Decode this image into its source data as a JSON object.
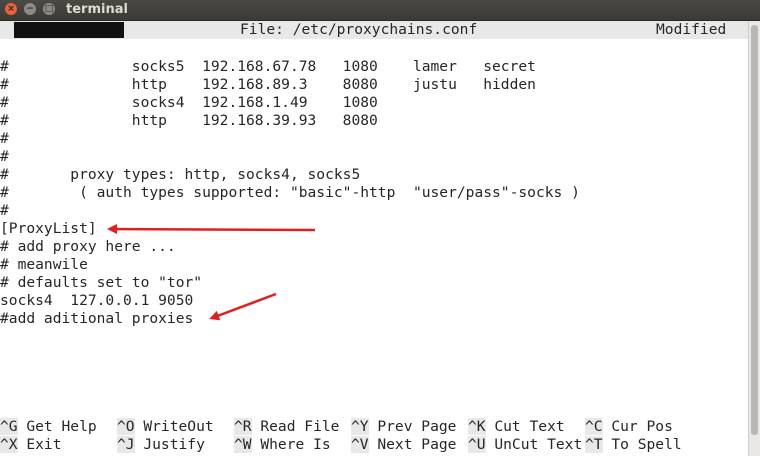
{
  "window": {
    "title": "terminal",
    "close_glyph": "×",
    "min_glyph": "−",
    "max_glyph": "□"
  },
  "nano": {
    "file_label": "File: /etc/proxychains.conf",
    "status": "Modified"
  },
  "editor_lines": [
    "#              socks5  192.168.67.78   1080    lamer   secret",
    "#              http    192.168.89.3    8080    justu   hidden",
    "#              socks4  192.168.1.49    1080",
    "#              http    192.168.39.93   8080",
    "#",
    "#",
    "#       proxy types: http, socks4, socks5",
    "#        ( auth types supported: \"basic\"-http  \"user/pass\"-socks )",
    "#",
    "[ProxyList]",
    "# add proxy here ...",
    "# meanwile",
    "# defaults set to \"tor\"",
    "socks4  127.0.0.1 9050",
    "#add aditional proxies"
  ],
  "shortcuts_row1": [
    {
      "key": "^G",
      "label": " Get Help"
    },
    {
      "key": "^O",
      "label": " WriteOut"
    },
    {
      "key": "^R",
      "label": " Read File"
    },
    {
      "key": "^Y",
      "label": " Prev Page"
    },
    {
      "key": "^K",
      "label": " Cut Text"
    },
    {
      "key": "^C",
      "label": " Cur Pos"
    }
  ],
  "shortcuts_row2": [
    {
      "key": "^X",
      "label": " Exit"
    },
    {
      "key": "^J",
      "label": " Justify"
    },
    {
      "key": "^W",
      "label": " Where Is"
    },
    {
      "key": "^V",
      "label": " Next Page"
    },
    {
      "key": "^U",
      "label": " UnCut Text"
    },
    {
      "key": "^T",
      "label": " To Spell"
    }
  ],
  "annotation_color": "#e02020",
  "annotations": [
    "arrow-to-proxylist",
    "arrow-to-add-proxies"
  ]
}
